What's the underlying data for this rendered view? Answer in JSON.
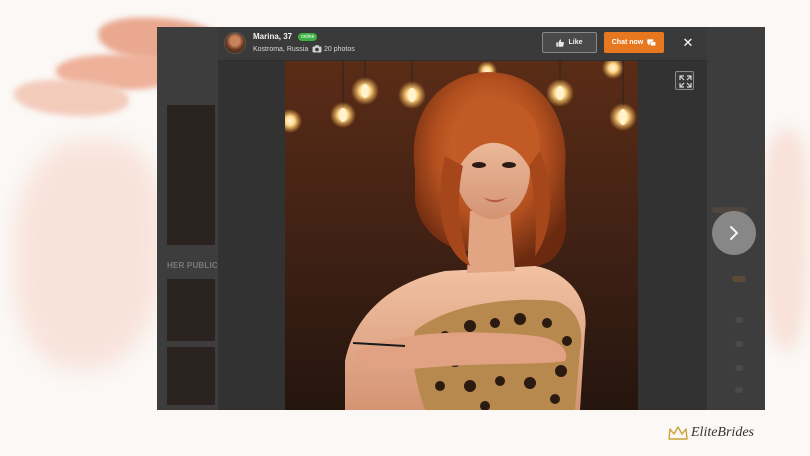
{
  "profile": {
    "name_age": "Marina, 37",
    "online_badge": "online",
    "location": "Kostroma, Russia",
    "photo_count": "20 photos"
  },
  "actions": {
    "like_label": "Like",
    "chat_label": "Chat now",
    "close_glyph": "✕"
  },
  "background_page": {
    "section_label": "HER PUBLIC P"
  },
  "brand": {
    "name": "EliteBrides"
  },
  "colors": {
    "accent_orange": "#e8781f",
    "online_green": "#3cb043",
    "brand_gold": "#c9a23a"
  },
  "icons": [
    "avatar",
    "camera-icon",
    "thumbs-up-icon",
    "chat-icon",
    "close-icon",
    "expand-icon",
    "chevron-right-icon",
    "crown-icon"
  ]
}
